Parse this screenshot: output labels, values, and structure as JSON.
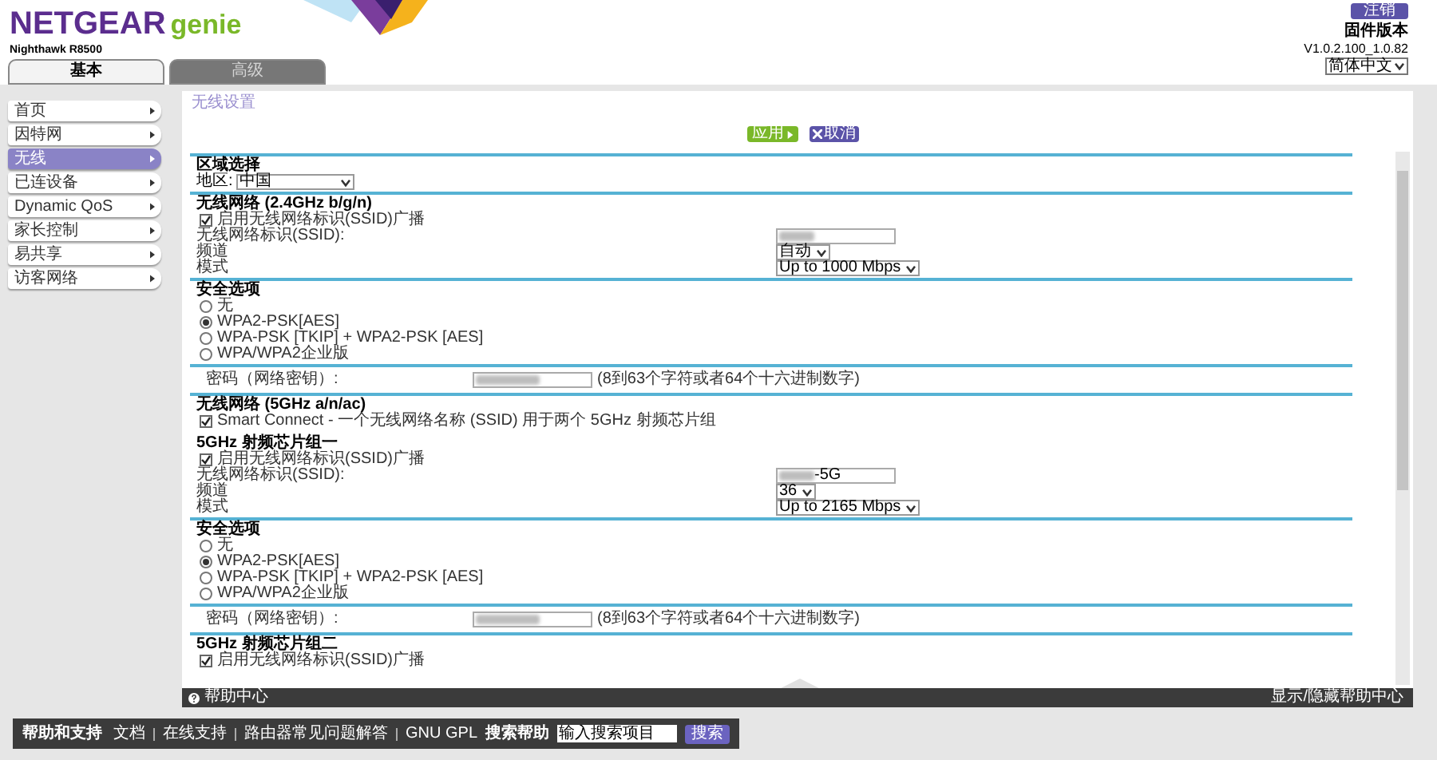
{
  "header": {
    "brand": "NETGEAR",
    "product": "genie",
    "model": "Nighthawk R8500",
    "logout": "注销",
    "firmware_label": "固件版本",
    "firmware": "V1.0.2.100_1.0.82",
    "language": "简体中文"
  },
  "tabs": [
    {
      "label": "基本",
      "selected": true
    },
    {
      "label": "高级",
      "selected": false
    }
  ],
  "sidebar": [
    {
      "label": "首页",
      "selected": false
    },
    {
      "label": "因特网",
      "selected": false
    },
    {
      "label": "无线",
      "selected": true
    },
    {
      "label": "已连设备",
      "selected": false
    },
    {
      "label": "Dynamic QoS",
      "selected": false
    },
    {
      "label": "家长控制",
      "selected": false
    },
    {
      "label": "易共享",
      "selected": false
    },
    {
      "label": "访客网络",
      "selected": false
    }
  ],
  "page_title": "无线设置",
  "actions": {
    "apply": "应用",
    "cancel": "取消"
  },
  "sections": [
    {
      "rows": [
        {
          "kind": "heading",
          "text": "区域选择"
        },
        {
          "kind": "inline_select",
          "label": "地区:",
          "value": "中国"
        }
      ]
    },
    {
      "rows": [
        {
          "kind": "heading",
          "text": "无线网络 (2.4GHz b/g/n)"
        },
        {
          "kind": "checkbox",
          "label": "启用无线网络标识(SSID)广播",
          "checked": true
        },
        {
          "kind": "text_field",
          "label": "无线网络标识(SSID):",
          "value": ""
        },
        {
          "kind": "select",
          "label": "频道",
          "value": "自动"
        },
        {
          "kind": "select",
          "label": "模式",
          "value": "Up to 1000 Mbps"
        }
      ]
    },
    {
      "rows": [
        {
          "kind": "heading",
          "text": "安全选项"
        },
        {
          "kind": "radio",
          "label": "无",
          "selected": false
        },
        {
          "kind": "radio",
          "label": "WPA2-PSK[AES]",
          "selected": true
        },
        {
          "kind": "radio",
          "label": "WPA-PSK [TKIP] + WPA2-PSK [AES]",
          "selected": false
        },
        {
          "kind": "radio",
          "label": "WPA/WPA2企业版",
          "selected": false
        }
      ]
    },
    {
      "rows": [
        {
          "kind": "password",
          "label": "密码（网络密钥）:",
          "hint": "(8到63个字符或者64个十六进制数字)"
        }
      ]
    },
    {
      "rows": [
        {
          "kind": "heading",
          "text": "无线网络 (5GHz a/n/ac)"
        },
        {
          "kind": "checkbox",
          "label": "Smart Connect - 一个无线网络名称 (SSID) 用于两个 5GHz 射频芯片组",
          "checked": true
        },
        {
          "kind": "spacer"
        },
        {
          "kind": "heading",
          "text": "5GHz 射频芯片组一"
        },
        {
          "kind": "checkbox",
          "label": "启用无线网络标识(SSID)广播",
          "checked": true
        },
        {
          "kind": "text_field",
          "label": "无线网络标识(SSID):",
          "value": "-5G"
        },
        {
          "kind": "select",
          "label": "频道",
          "value": "36"
        },
        {
          "kind": "select",
          "label": "模式",
          "value": "Up to 2165 Mbps"
        }
      ]
    },
    {
      "rows": [
        {
          "kind": "heading",
          "text": "安全选项"
        },
        {
          "kind": "radio",
          "label": "无",
          "selected": false
        },
        {
          "kind": "radio",
          "label": "WPA2-PSK[AES]",
          "selected": true
        },
        {
          "kind": "radio",
          "label": "WPA-PSK [TKIP] + WPA2-PSK [AES]",
          "selected": false
        },
        {
          "kind": "radio",
          "label": "WPA/WPA2企业版",
          "selected": false
        }
      ]
    },
    {
      "rows": [
        {
          "kind": "password",
          "label": "密码（网络密钥）:",
          "hint": "(8到63个字符或者64个十六进制数字)"
        }
      ]
    },
    {
      "rows": [
        {
          "kind": "heading",
          "text": "5GHz 射频芯片组二"
        },
        {
          "kind": "checkbox",
          "label": "启用无线网络标识(SSID)广播",
          "checked": true
        }
      ]
    }
  ],
  "help_bar": {
    "title": "帮助中心",
    "toggle": "显示/隐藏帮助中心"
  },
  "footer": {
    "title": "帮助和支持",
    "links": [
      "文档",
      "在线支持",
      "路由器常见问题解答",
      "GNU GPL"
    ],
    "search_label": "搜索帮助",
    "search_placeholder": "输入搜索项目",
    "search_button": "搜索"
  }
}
